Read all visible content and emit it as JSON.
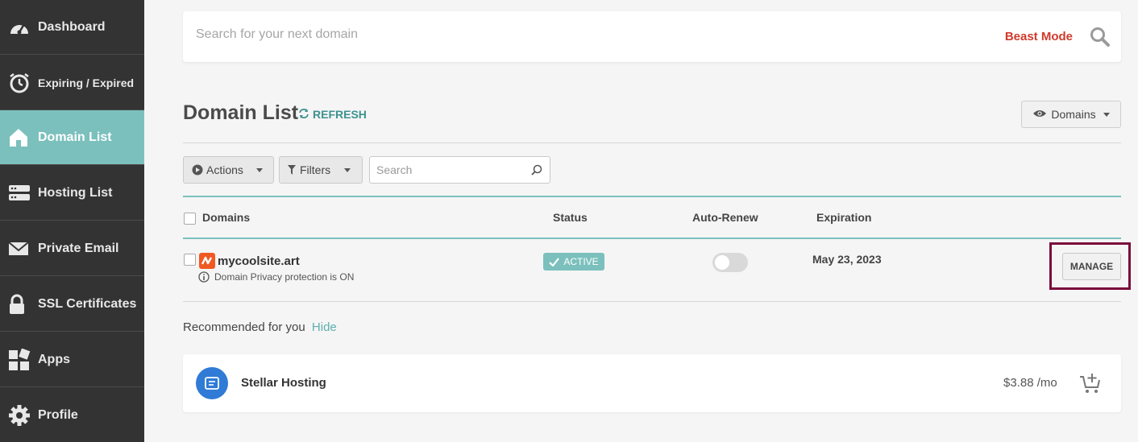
{
  "sidebar": {
    "items": [
      {
        "label": "Dashboard",
        "icon": "gauge-icon"
      },
      {
        "label": "Expiring / Expired",
        "icon": "timer-icon"
      },
      {
        "label": "Domain List",
        "icon": "home-icon",
        "active": true
      },
      {
        "label": "Hosting List",
        "icon": "server-icon"
      },
      {
        "label": "Private Email",
        "icon": "envelope-icon"
      },
      {
        "label": "SSL Certificates",
        "icon": "lock-icon"
      },
      {
        "label": "Apps",
        "icon": "apps-grid-icon"
      },
      {
        "label": "Profile",
        "icon": "gear-icon"
      }
    ]
  },
  "search": {
    "placeholder": "Search for your next domain",
    "beast_mode": "Beast Mode"
  },
  "header": {
    "title": "Domain List",
    "refresh": "REFRESH",
    "view_dropdown": "Domains"
  },
  "toolbar": {
    "actions": "Actions",
    "filters": "Filters",
    "search_placeholder": "Search"
  },
  "table": {
    "columns": {
      "domains": "Domains",
      "status": "Status",
      "auto_renew": "Auto-Renew",
      "expiration": "Expiration"
    },
    "rows": [
      {
        "domain": "mycoolsite.art",
        "note": "Domain Privacy protection is ON",
        "status": "ACTIVE",
        "auto_renew": false,
        "expiration": "May 23, 2023",
        "action": "MANAGE"
      }
    ]
  },
  "recommended": {
    "label": "Recommended for you",
    "hide": "Hide",
    "product": {
      "name": "Stellar Hosting",
      "price": "$3.88 /mo"
    }
  },
  "colors": {
    "sidebar": "#333333",
    "accent": "#7bc0bd",
    "beast": "#d03a2c",
    "highlight": "#7a0a3b",
    "product": "#2f7bd6"
  }
}
